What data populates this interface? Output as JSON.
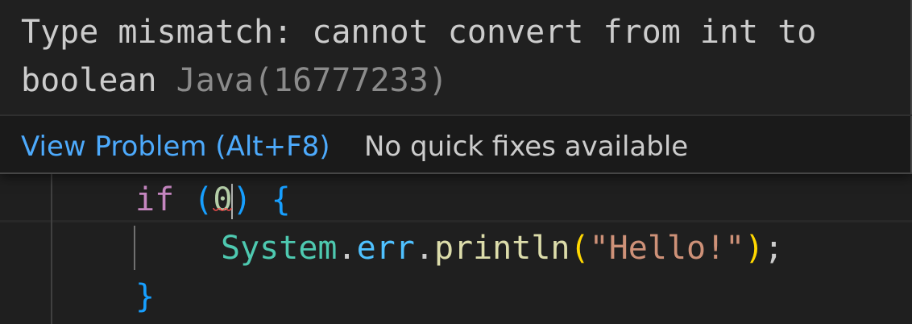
{
  "hover": {
    "message": "Type mismatch: cannot convert from int to boolean",
    "source": "Java(16777233)",
    "view_problem_label": "View Problem (Alt+F8)",
    "no_fixes_label": "No quick fixes available"
  },
  "code": {
    "line_if": {
      "keyword": "if",
      "space": " ",
      "open_paren": "(",
      "number": "0",
      "close_paren": ")",
      "space2": " ",
      "open_brace": "{"
    },
    "line_print": {
      "type": "System",
      "dot1": ".",
      "field": "err",
      "dot2": ".",
      "method": "println",
      "open_paren": "(",
      "string": "\"Hello!\"",
      "close_paren": ")",
      "semicolon": ";"
    },
    "line_close": {
      "close_brace": "}"
    }
  },
  "colors": {
    "keyword": "#c586c0",
    "brace": "#179fff",
    "number": "#b5cea8",
    "type": "#4ec9b0",
    "field": "#4fc1ff",
    "method": "#dcdcaa",
    "string": "#ce9178",
    "error_squiggle": "#f14c4c",
    "link": "#4daafc"
  }
}
